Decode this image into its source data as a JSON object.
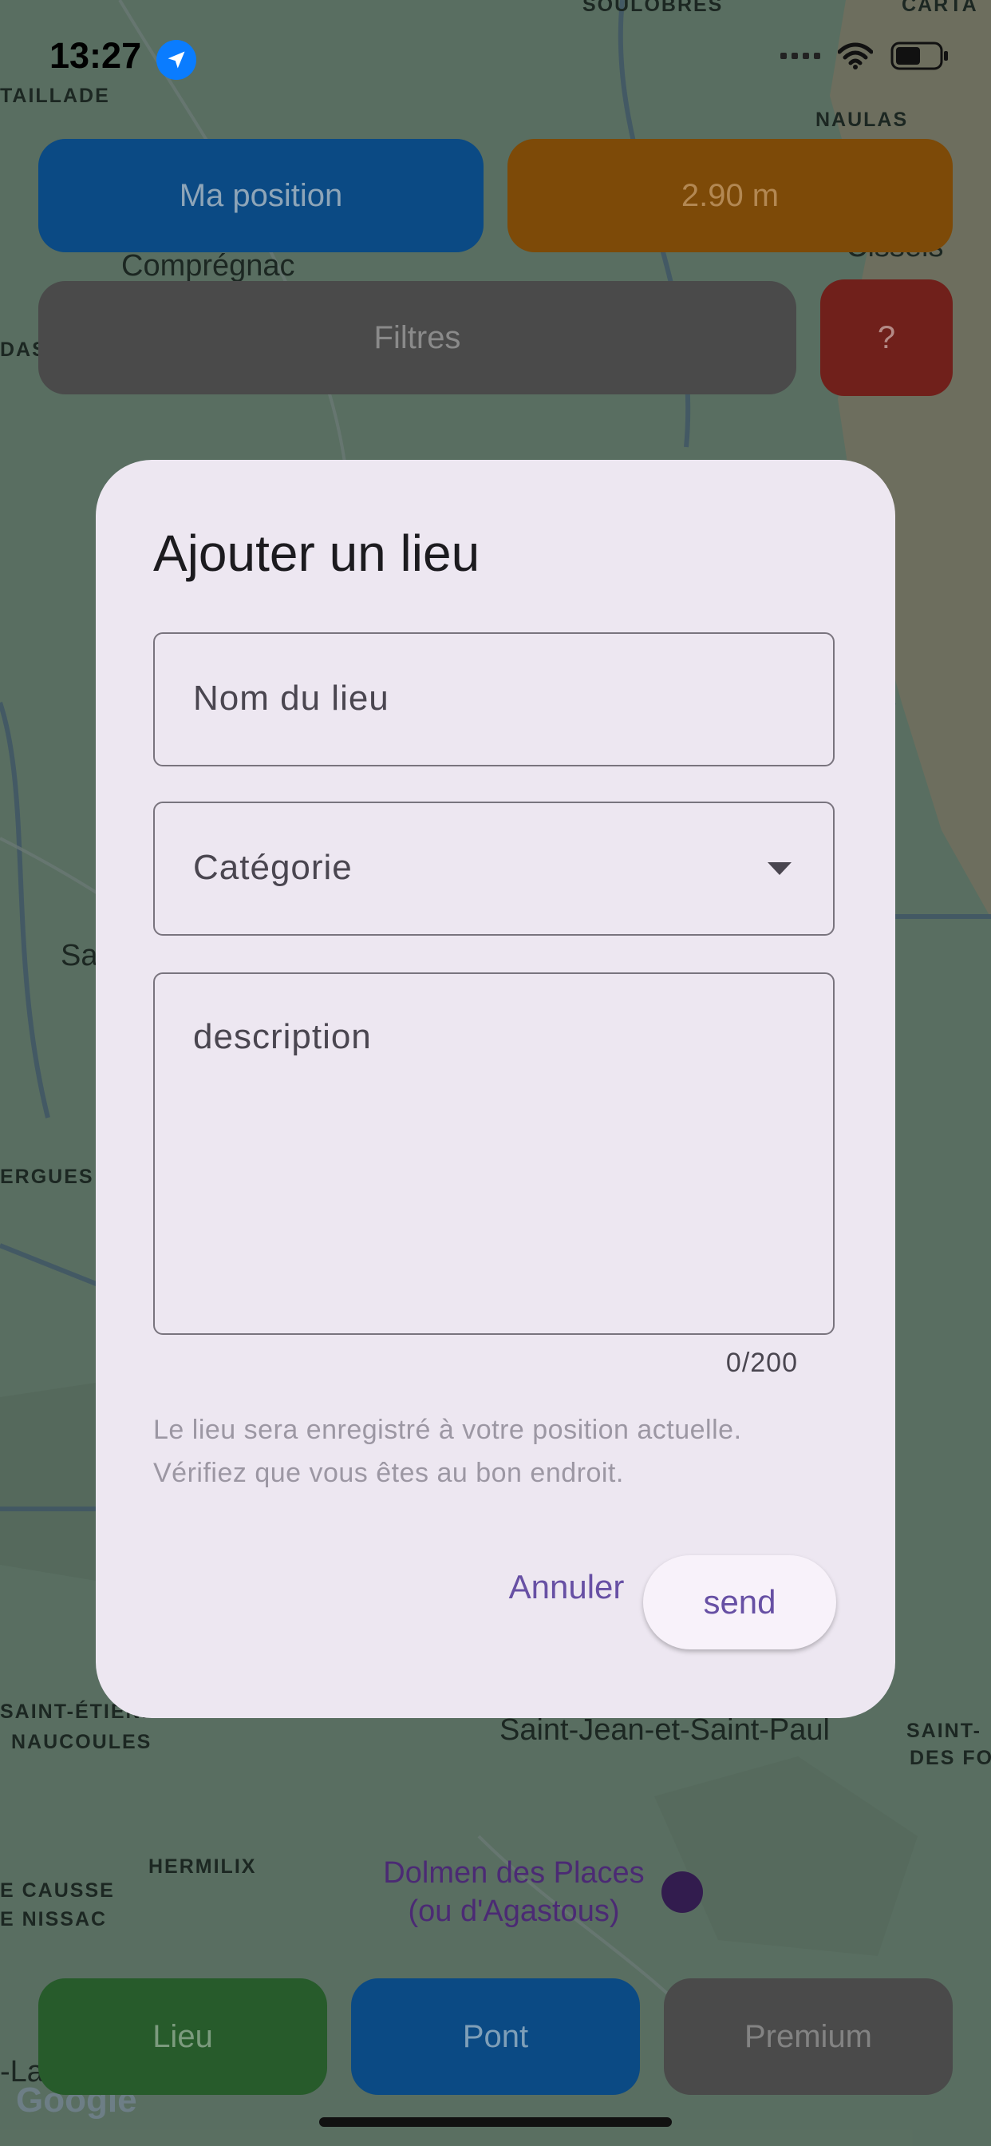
{
  "status_bar": {
    "time": "13:27"
  },
  "map": {
    "labels": {
      "soulobres": "SOULOBRES",
      "cartas": "CARTA",
      "taillade": "TAILLADE",
      "naulas": "NAULAS",
      "compregnac": "Comprégnac",
      "das": "DAS",
      "saint_george": "Saint-Ge",
      "crissels": "Cissels",
      "sa": "Sa",
      "ergues": "ERGUES",
      "saint_etienne": "SAINT-ÉTIENNE",
      "naucoules": "NAUCOULES",
      "saint_jean": "Saint-Jean-et-Saint-Paul",
      "saint_right_1": "SAINT-",
      "saint_right_2": "DES FO",
      "hermilix": "HERMILIX",
      "causse": "E CAUSSE",
      "nissac": "E NISSAC",
      "poi_line1": "Dolmen des Places",
      "poi_line2": "(ou d'Agastous)",
      "la": "-La",
      "google": "Google"
    }
  },
  "top_buttons": {
    "position": "Ma position",
    "distance": "2.90 m",
    "filters": "Filtres",
    "help": "?"
  },
  "bottom_buttons": {
    "lieu": "Lieu",
    "pont": "Pont",
    "premium": "Premium"
  },
  "dialog": {
    "title": "Ajouter un lieu",
    "name_label": "Nom du lieu",
    "category_label": "Catégorie",
    "description_label": "description",
    "counter": "0/200",
    "info_line1": "Le lieu sera enregistré à votre position actuelle.",
    "info_line2": "Vérifiez que vous êtes au bon endroit.",
    "cancel": "Annuler",
    "send": "send"
  },
  "colors": {
    "accent": "#6750a4",
    "dialog_bg": "#ede7f1",
    "btn_blue": "#0b4a84",
    "btn_orange": "#7d4a08",
    "btn_red": "#70201b",
    "btn_green": "#275b2b"
  }
}
